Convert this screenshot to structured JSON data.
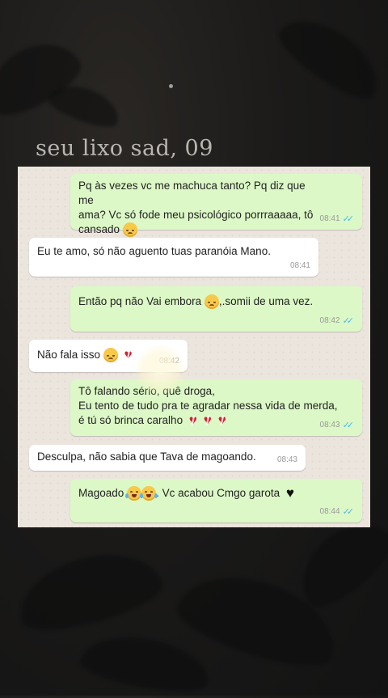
{
  "story": {
    "title": "seu lixo sad, 09"
  },
  "colors": {
    "outgoing_bubble": "#dcf8c6",
    "incoming_bubble": "#ffffff",
    "read_ticks": "#4fb6ec",
    "chat_background": "#ebe5dd"
  },
  "messages": [
    {
      "direction": "out",
      "lines": [
        "Pq às vezes vc  me machuca tanto? Pq diz que me",
        "ama? Vc só fode meu psicológico porrraaaaa, tô",
        "cansado"
      ],
      "emojis": [
        "disappointed-face"
      ],
      "time": "08:41",
      "status": "read"
    },
    {
      "direction": "in",
      "lines": [
        "Eu te amo, só não aguento tuas paranóia Mano."
      ],
      "emojis": [],
      "time": "08:41"
    },
    {
      "direction": "out",
      "text_before": "Então pq não Vai embora",
      "text_after": ",.somii de uma vez.",
      "emojis": [
        "disappointed-face"
      ],
      "time": "08:42",
      "status": "read"
    },
    {
      "direction": "in",
      "text": "Não fala isso",
      "emojis": [
        "disappointed-face",
        "broken-heart"
      ],
      "time": "08:42"
    },
    {
      "direction": "out",
      "lines": [
        "Tô falando sério, quê droga,",
        "Eu tento de tudo pra te agradar nessa vida de merda,",
        "é tú só brinca caralho"
      ],
      "emojis": [
        "broken-heart",
        "broken-heart",
        "broken-heart"
      ],
      "time": "08:43",
      "status": "read"
    },
    {
      "direction": "in",
      "text": "Desculpa, não sabia que Tava de magoando.",
      "emojis": [],
      "time": "08:43"
    },
    {
      "direction": "out",
      "text_before": "Magoado",
      "text_after": ". Vc acabou Cmgo garota",
      "emojis": [
        "tears-of-joy",
        "tears-of-joy",
        "black-heart"
      ],
      "time": "08:44",
      "status": "read"
    }
  ]
}
